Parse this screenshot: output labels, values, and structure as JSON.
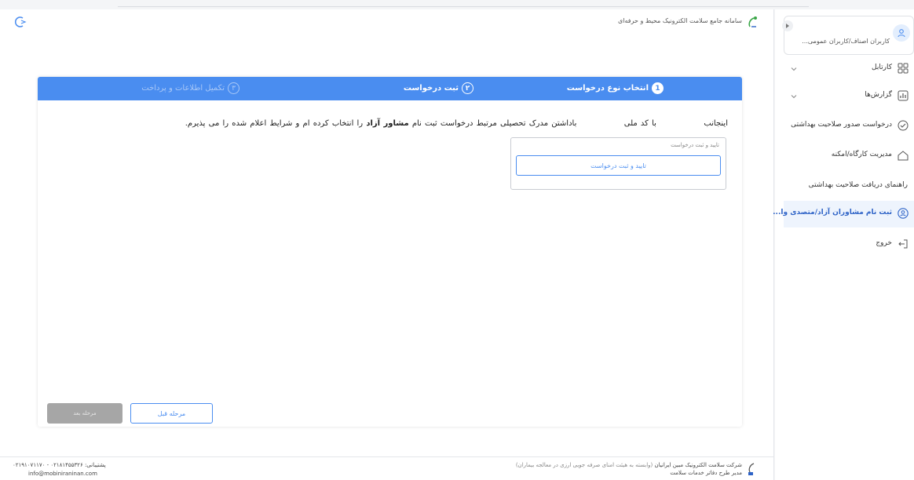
{
  "header": {
    "title": "سامانه جامع سلامت الکترونیک محیط و حرفه‌ای"
  },
  "stepper": {
    "steps": [
      {
        "num": "1",
        "label": "انتخاب نوع درخواست"
      },
      {
        "num": "۲",
        "label": "ثبت درخواست"
      },
      {
        "num": "۳",
        "label": "تکمیل اطلاعات و پرداخت"
      }
    ]
  },
  "agreement": {
    "part1": "اینجانب",
    "part2": "با کد ملی",
    "part3": "باداشتن مدرک تحصیلی مرتبط درخواست ثبت نام",
    "bold": "مشاور آزاد",
    "part4": "را انتخاب کرده ام و شرایط اعلام شده را می پذیرم."
  },
  "confirm_box": {
    "title": "تایید و ثبت درخواست",
    "button": "تایید و ثبت درخواست"
  },
  "nav_buttons": {
    "prev": "مرحله قبل",
    "next": "مرحله بعد"
  },
  "footer": {
    "company": "شرکت سلامت الکترونیک مبین ایرانیان",
    "company_note": "(وابسته به هیئت امنای صرفه جویی ارزی در معالجه بیماران)",
    "manager": "مدیر طرح دفاتر خدمات سلامت",
    "support_label": "پشتیبانی:",
    "support_phones": "۰۲۱۸۱۴۵۵۳۲۶ - ۰۲۱۹۱۰۷۱۱۷۰",
    "email": "info@mobiniraninan.com"
  },
  "sidebar": {
    "user_role": "کاربران اصناف/کاربران عمومی...",
    "items": [
      {
        "label": "کارتابل",
        "icon": "grid-icon",
        "has_chevron": true,
        "active": false
      },
      {
        "label": "گزارش‌ها",
        "icon": "report-icon",
        "has_chevron": true,
        "active": false
      },
      {
        "label": "درخواست صدور صلاحیت بهداشتی",
        "icon": "check-circle-icon",
        "has_chevron": false,
        "active": false
      },
      {
        "label": "مدیریت کارگاه/امکنه",
        "icon": "home-icon",
        "has_chevron": false,
        "active": false
      },
      {
        "label": "راهنمای دریافت صلاحیت بهداشتی",
        "icon": "",
        "has_chevron": false,
        "active": false
      },
      {
        "label": "ثبت نام مشاوران آزاد/متصدی وا...",
        "icon": "user-badge-icon",
        "has_chevron": false,
        "active": true
      },
      {
        "label": "خروج",
        "icon": "logout-icon",
        "has_chevron": false,
        "active": false
      }
    ]
  },
  "colors": {
    "primary": "#4a8df0",
    "active_bg": "#eef4fd",
    "disabled_button": "#a6a6a6"
  }
}
